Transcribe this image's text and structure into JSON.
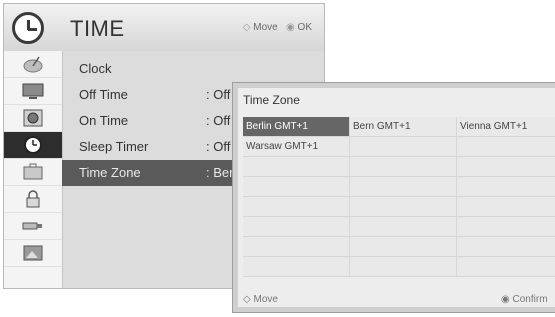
{
  "header": {
    "title": "TIME",
    "move_hint": "Move",
    "ok_hint": "OK"
  },
  "sidebar_icons": [
    "satellite-dish-icon",
    "monitor-icon",
    "speaker-icon",
    "clock-icon",
    "briefcase-icon",
    "lock-icon",
    "usb-icon",
    "photo-icon"
  ],
  "menu": {
    "items": [
      {
        "label": "Clock",
        "value": ""
      },
      {
        "label": "Off Time",
        "value": ": Off"
      },
      {
        "label": "On Time",
        "value": ": Off"
      },
      {
        "label": "Sleep Timer",
        "value": ": Off"
      },
      {
        "label": "Time Zone",
        "value": ": Berl"
      }
    ]
  },
  "popup": {
    "title": "Time Zone",
    "zones": [
      [
        "Berlin GMT+1",
        "Bern GMT+1",
        "Vienna GMT+1"
      ],
      [
        "Warsaw GMT+1",
        "",
        ""
      ]
    ],
    "footer_left": "Move",
    "footer_right": "Confirm"
  }
}
